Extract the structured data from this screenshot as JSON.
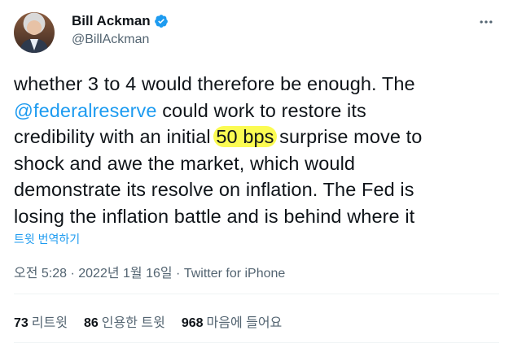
{
  "author": {
    "display_name": "Bill Ackman",
    "handle": "@BillAckman",
    "verified": true,
    "avatar_icon": "avatar-photo",
    "verified_icon": "verified-badge-icon"
  },
  "tweet": {
    "lines": [
      [
        "whether 3 to 4 would therefore be enough. The"
      ],
      [
        "@federalreserve",
        " could work to restore its"
      ],
      [
        "credibility with an initial ",
        "50 bps",
        " surprise move to"
      ],
      [
        "shock and awe the market, which would"
      ],
      [
        "demonstrate its resolve on inflation. The Fed is"
      ],
      [
        "losing the inflation battle and is behind where it"
      ]
    ],
    "mention": "@federalreserve",
    "highlight": "50 bps",
    "highlight_color": "#fbfb52",
    "translate_label": "트윗 번역하기"
  },
  "meta": {
    "time": "오전 5:28",
    "separator": " · ",
    "date": "2022년 1월 16일",
    "source": "Twitter for iPhone"
  },
  "stats": {
    "retweets_count": "73",
    "retweets_label": "리트윗",
    "quotes_count": "86",
    "quotes_label": "인용한 트윗",
    "likes_count": "968",
    "likes_label": "마음에 들어요"
  },
  "colors": {
    "accent": "#1d9bf0",
    "secondary_text": "#536471",
    "primary_text": "#0f1419"
  }
}
